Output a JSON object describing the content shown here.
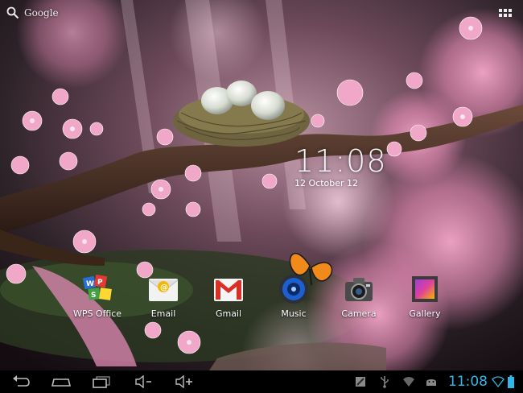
{
  "search": {
    "label": "Google"
  },
  "clock": {
    "time": "11:08",
    "date": "12 October 12"
  },
  "apps": [
    {
      "label": "WPS Office",
      "icon": "wps-office-icon"
    },
    {
      "label": "Email",
      "icon": "email-icon"
    },
    {
      "label": "Gmail",
      "icon": "gmail-icon"
    },
    {
      "label": "Music",
      "icon": "music-icon"
    },
    {
      "label": "Camera",
      "icon": "camera-icon"
    },
    {
      "label": "Gallery",
      "icon": "gallery-icon"
    }
  ],
  "statusbar": {
    "time": "11:08"
  },
  "colors": {
    "accent": "#33b5e5",
    "navbar": "#000000"
  }
}
